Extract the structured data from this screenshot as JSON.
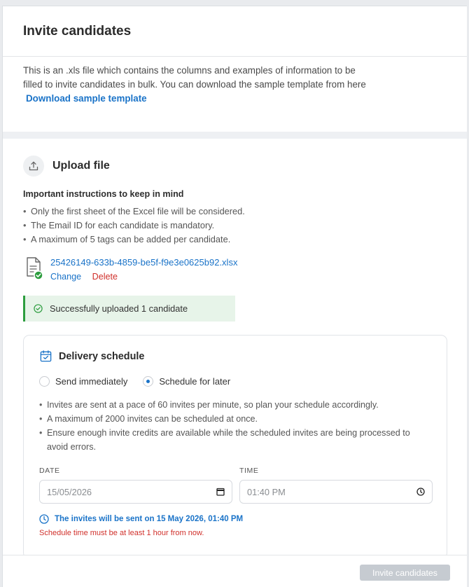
{
  "header": {
    "title": "Invite candidates"
  },
  "intro": {
    "text": "This is an .xls file which contains the columns and examples of information to be filled to invite candidates in bulk. You can download the sample template from here",
    "link": "Download sample template"
  },
  "upload": {
    "title": "Upload file",
    "instructions_title": "Important instructions to keep in mind",
    "instructions": [
      "Only the first sheet of the Excel file will be considered.",
      "The Email ID for each candidate is mandatory.",
      "A maximum of 5 tags can be added per candidate."
    ],
    "file": {
      "name": "25426149-633b-4859-be5f-f9e3e0625b92.xlsx",
      "change_label": "Change",
      "delete_label": "Delete"
    },
    "success_message": "Successfully uploaded 1 candidate"
  },
  "schedule": {
    "title": "Delivery schedule",
    "options": [
      {
        "label": "Send immediately",
        "selected": false
      },
      {
        "label": "Schedule for later",
        "selected": true
      }
    ],
    "notes": [
      "Invites are sent at a pace of 60 invites per minute, so plan your schedule accordingly.",
      "A maximum of 2000 invites can be scheduled at once.",
      "Ensure enough invite credits are available while the scheduled invites are being processed to avoid errors."
    ],
    "date_label": "DATE",
    "date_value": "15/05/2026",
    "time_label": "TIME",
    "time_value": "01:40 PM",
    "info": "The invites will be sent on 15 May 2026, 01:40 PM",
    "error": "Schedule time must be at least 1 hour from now."
  },
  "footer": {
    "submit_label": "Invite candidates"
  },
  "colors": {
    "accent": "#1a73c8",
    "danger": "#d0302b",
    "success": "#2d9d3f",
    "disabled": "#c6cbd1"
  }
}
